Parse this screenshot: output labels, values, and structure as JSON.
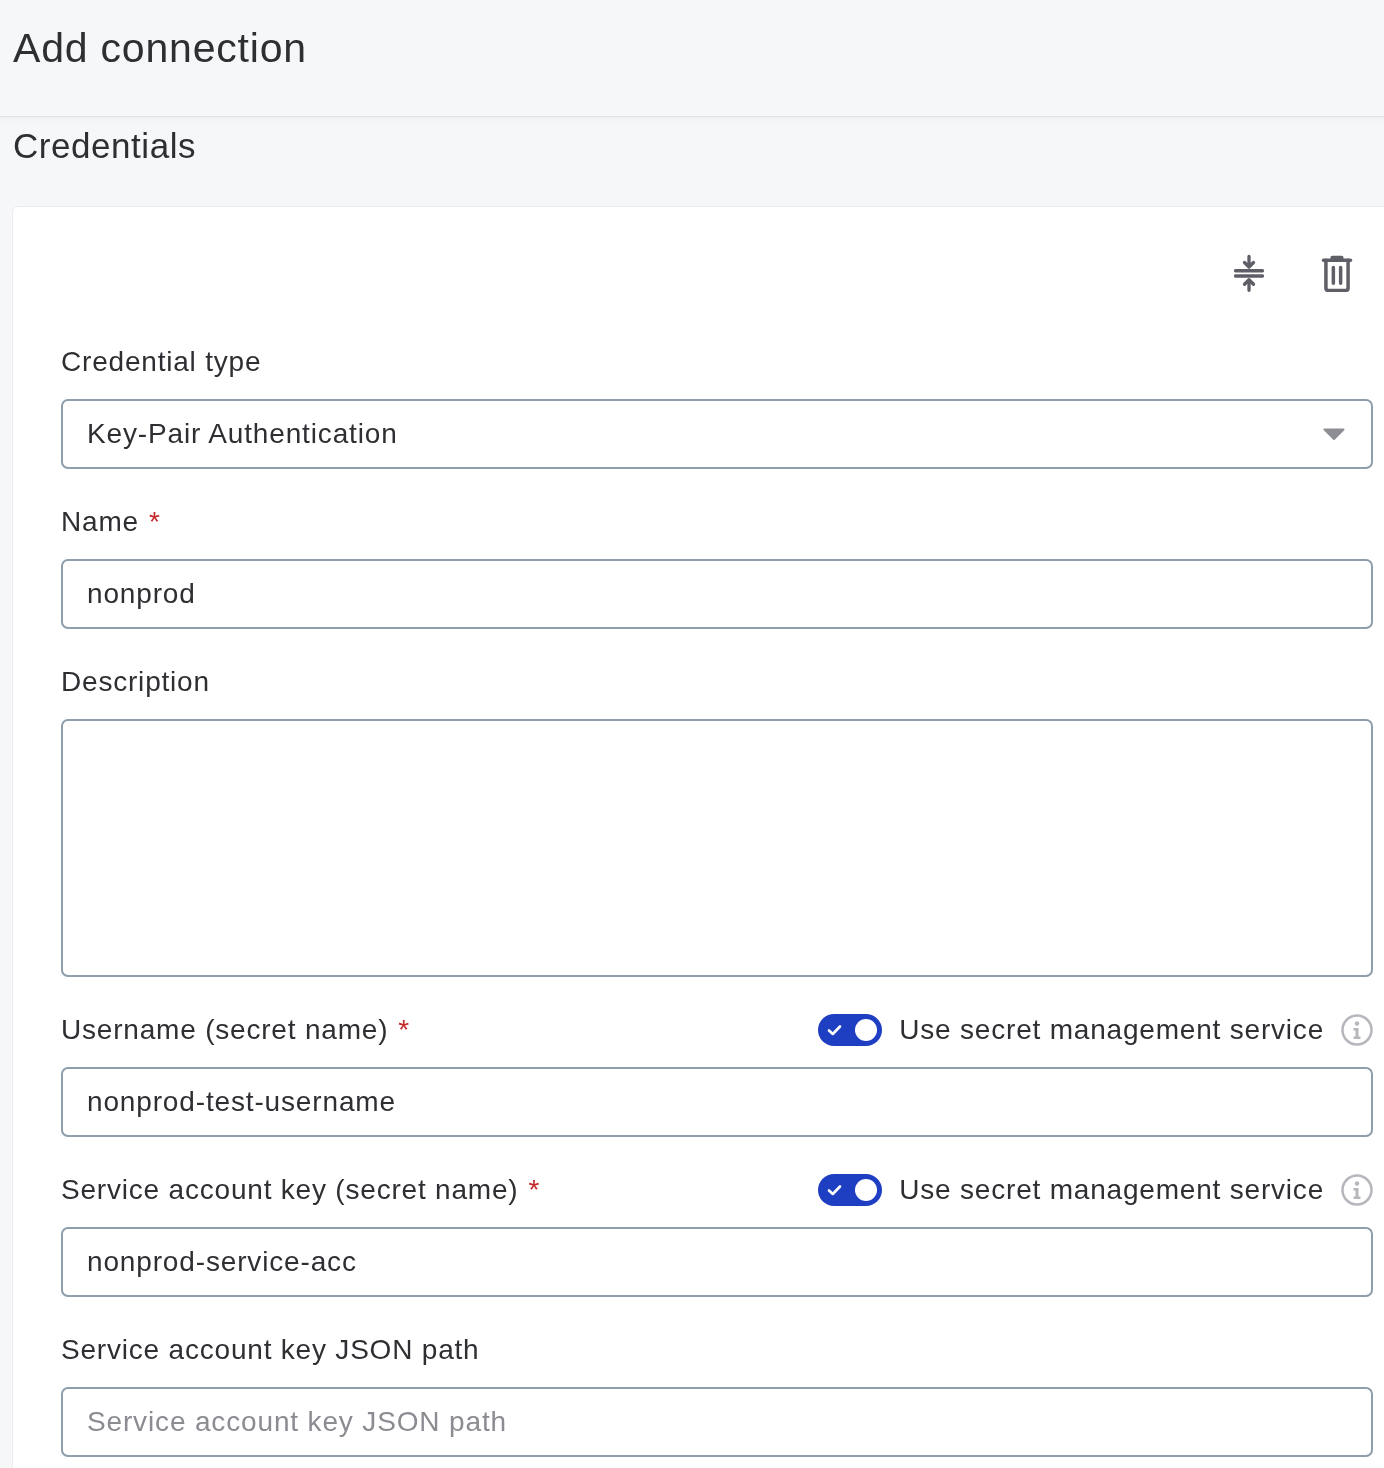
{
  "header": {
    "title": "Add connection"
  },
  "section": {
    "title": "Credentials"
  },
  "fields": [
    {
      "kind": "select",
      "label": "Credential type",
      "value": "Key-Pair Authentication"
    },
    {
      "kind": "text",
      "label": "Name",
      "required_mark": "*",
      "value": "nonprod"
    },
    {
      "kind": "textarea",
      "label": "Description"
    },
    {
      "kind": "text",
      "label": "Username (secret name)",
      "required_mark": "*",
      "secret_toggle": {
        "on": true,
        "label": "Use secret management service"
      },
      "value": "nonprod-test-username"
    },
    {
      "kind": "text",
      "label": "Service account key (secret name)",
      "required_mark": "*",
      "secret_toggle": {
        "on": true,
        "label": "Use secret management service"
      },
      "value": "nonprod-service-acc"
    },
    {
      "kind": "text",
      "label": "Service account key JSON path",
      "placeholder": "Service account key JSON path"
    }
  ]
}
